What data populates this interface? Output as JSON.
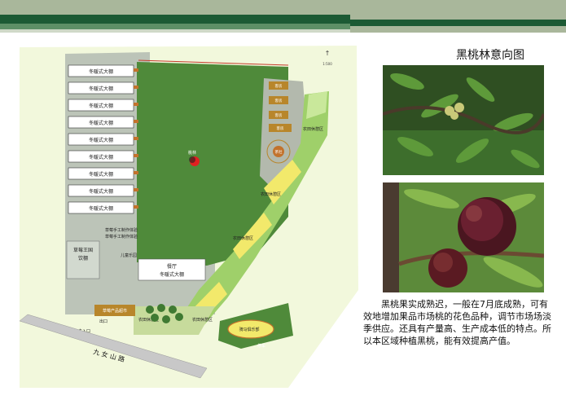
{
  "title": "黑桃林意向图",
  "description": "黑桃果实成熟迟，一般在7月底成熟，可有效地增加果品市场桃的花色品种，调节市场场淡季供应。还具有产量高、生产成本低的特点。所以本区域种植黑桃，能有效提高产值。",
  "plan": {
    "scale_label": "1:500",
    "greenhouses": [
      "冬暖式大棚",
      "冬暖式大棚",
      "冬暖式大棚",
      "冬暖式大棚",
      "冬暖式大棚",
      "冬暖式大棚",
      "冬暖式大棚",
      "冬暖式大棚",
      "冬暖式大棚"
    ],
    "black_peach_label": "桃林",
    "strawberry_castle": "草莓王国",
    "strawberry_castle_sub": "饮棚",
    "strawberry_workshop": "草莓手工制作体验",
    "strawberry_workshop2": "草莓手工制作体验",
    "entertainment": "儿童乐园",
    "restaurant": "餐厅",
    "restaurant_greenhouse": "冬暖式大棚",
    "tea_label": "茶社",
    "farm_products": "草莓产品超市",
    "exit": "出口",
    "main_entrance": "主入口",
    "road": "九 女 山 路",
    "leisure_area_1": "农田休憩区",
    "leisure_area_2": "农田休憩区",
    "leisure_area_3": "农田休憩区",
    "leisure_area_4": "农田休憩区",
    "leisure_area_5": "农田休憩区",
    "horse_club": "骑马俱乐部",
    "parking": "停车",
    "buildings_right": [
      "客房",
      "客房",
      "客房",
      "客房"
    ]
  },
  "colors": {
    "band_dark": "#1c5a34",
    "grass": "#4f8a3a",
    "leaf": "#4d7a2b"
  }
}
